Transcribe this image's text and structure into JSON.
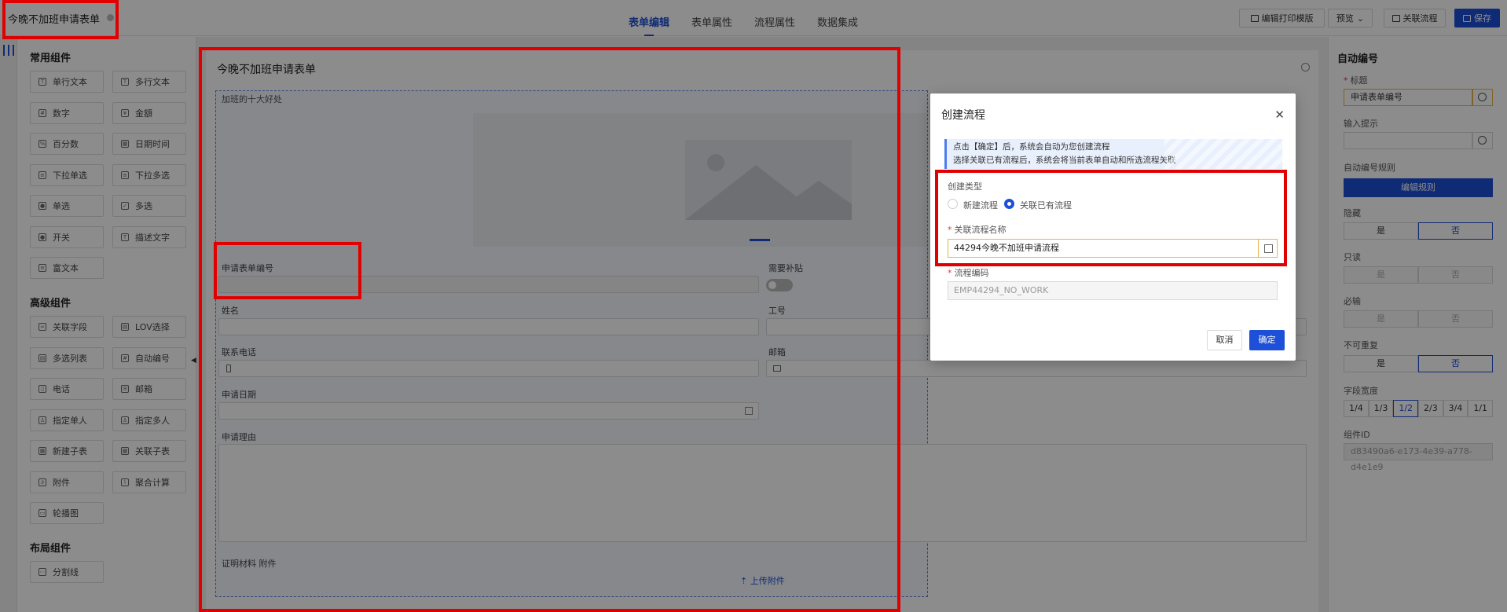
{
  "app": {
    "title": "今晚不加班申请表单"
  },
  "tabs": [
    {
      "label": "表单编辑",
      "active": true
    },
    {
      "label": "表单属性",
      "active": false
    },
    {
      "label": "流程属性",
      "active": false
    },
    {
      "label": "数据集成",
      "active": false
    }
  ],
  "toolbar": {
    "print_template": "编辑打印模版",
    "preview": "预览",
    "link_flow": "关联流程",
    "save": "保存"
  },
  "palette": {
    "common_title": "常用组件",
    "common": [
      "单行文本",
      "多行文本",
      "数字",
      "金額",
      "百分数",
      "日期时间",
      "下拉单选",
      "下拉多选",
      "单选",
      "多选",
      "开关",
      "描述文字",
      "富文本"
    ],
    "advanced_title": "高级组件",
    "advanced": [
      "关联字段",
      "LOV选择",
      "多选列表",
      "自动编号",
      "电话",
      "邮箱",
      "指定单人",
      "指定多人",
      "新建子表",
      "关联子表",
      "附件",
      "聚合计算",
      "轮播图"
    ],
    "layout_title": "布局组件",
    "layout": [
      "分割线"
    ]
  },
  "form": {
    "title": "今晚不加班申请表单",
    "zone_label": "加班的十大好处",
    "fields": {
      "form_no": "申请表单编号",
      "subsidy": "需要补贴",
      "name": "姓名",
      "emp_no": "工号",
      "phone": "联系电话",
      "email": "邮箱",
      "date": "申请日期",
      "reason": "申请理由",
      "attachment": "证明材料 附件"
    },
    "upload": "上传附件"
  },
  "props": {
    "title": "自动编号",
    "label_title": "标题",
    "title_value": "申请表单编号",
    "label_hint": "输入提示",
    "label_rule": "自动编号规则",
    "rule_button": "编辑规则",
    "label_hidden": "隐藏",
    "label_readonly": "只读",
    "label_required": "必输",
    "label_unique": "不可重复",
    "yes": "是",
    "no": "否",
    "label_width": "字段宽度",
    "widths": [
      "1/4",
      "1/3",
      "1/2",
      "2/3",
      "3/4",
      "1/1"
    ],
    "width_selected": "1/2",
    "label_id": "组件ID",
    "id_value": "d83490a6-e173-4e39-a778-d4e1e9"
  },
  "modal": {
    "title": "创建流程",
    "info_line1": "点击【确定】后，系统会自动为您创建流程",
    "info_line2": "选择关联已有流程后，系统会将当前表单自动和所选流程关联",
    "type_label": "创建类型",
    "option_new": "新建流程",
    "option_link": "关联已有流程",
    "selected_option": "关联已有流程",
    "flow_name_label": "关联流程名称",
    "flow_name_value": "44294今晚不加班申请流程",
    "flow_code_label": "流程编码",
    "flow_code_value": "EMP44294_NO_WORK",
    "cancel": "取消",
    "ok": "确定"
  },
  "colors": {
    "primary": "#1e4fd8",
    "annotation": "#e00000",
    "warning_border": "#e8b44b"
  }
}
